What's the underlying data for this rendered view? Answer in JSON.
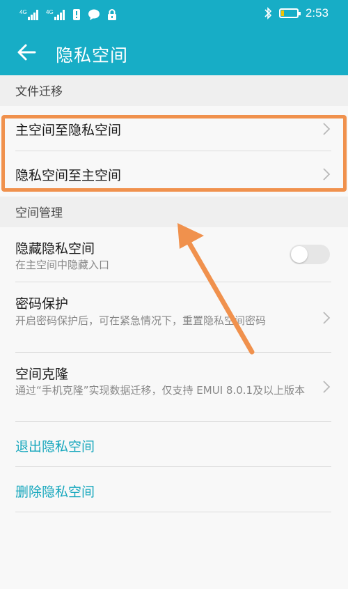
{
  "status_bar": {
    "signal_1": "4G",
    "signal_2": "4G",
    "time": "2:53",
    "icons": [
      "signal-4g-icon",
      "signal-4g-icon",
      "sim-alert-icon",
      "chat-icon",
      "lock-icon",
      "bluetooth-icon",
      "battery-icon"
    ]
  },
  "app_bar": {
    "title": "隐私空间",
    "back_icon": "arrow-left-icon"
  },
  "file_migration": {
    "header": "文件迁移",
    "items": [
      {
        "label": "主空间至隐私空间"
      },
      {
        "label": "隐私空间至主空间"
      }
    ]
  },
  "space_management": {
    "header": "空间管理",
    "hide_space": {
      "title": "隐藏隐私空间",
      "subtitle": "在主空间中隐藏入口",
      "toggle_on": false
    },
    "password_protect": {
      "title": "密码保护",
      "subtitle": "开启密码保护后，可在紧急情况下，重置隐私空间密码"
    },
    "space_clone": {
      "title": "空间克隆",
      "subtitle": "通过“手机克隆”实现数据迁移，仅支持 EMUI 8.0.1及以上版本"
    }
  },
  "actions": {
    "exit_label": "退出隐私空间",
    "delete_label": "删除隐私空间"
  },
  "colors": {
    "accent": "#17adc6",
    "link": "#16a7bd",
    "highlight": "#f0914d"
  }
}
